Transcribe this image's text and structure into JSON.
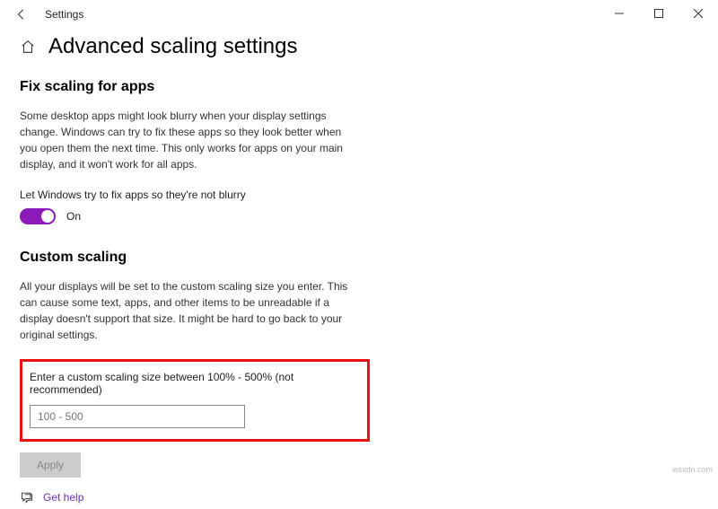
{
  "window": {
    "title": "Settings"
  },
  "page": {
    "heading": "Advanced scaling settings"
  },
  "fixScaling": {
    "heading": "Fix scaling for apps",
    "description": "Some desktop apps might look blurry when your display settings change. Windows can try to fix these apps so they look better when you open them the next time. This only works for apps on your main display, and it won't work for all apps.",
    "toggleLabel": "Let Windows try to fix apps so they're not blurry",
    "toggleState": "On"
  },
  "customScaling": {
    "heading": "Custom scaling",
    "description": "All your displays will be set to the custom scaling size you enter. This can cause some text, apps, and other items to be unreadable if a display doesn't support that size. It might be hard to go back to your original settings.",
    "inputLabel": "Enter a custom scaling size between 100% - 500% (not recommended)",
    "placeholder": "100 - 500",
    "applyLabel": "Apply"
  },
  "help": {
    "label": "Get help"
  },
  "watermark": "wsxdn.com"
}
